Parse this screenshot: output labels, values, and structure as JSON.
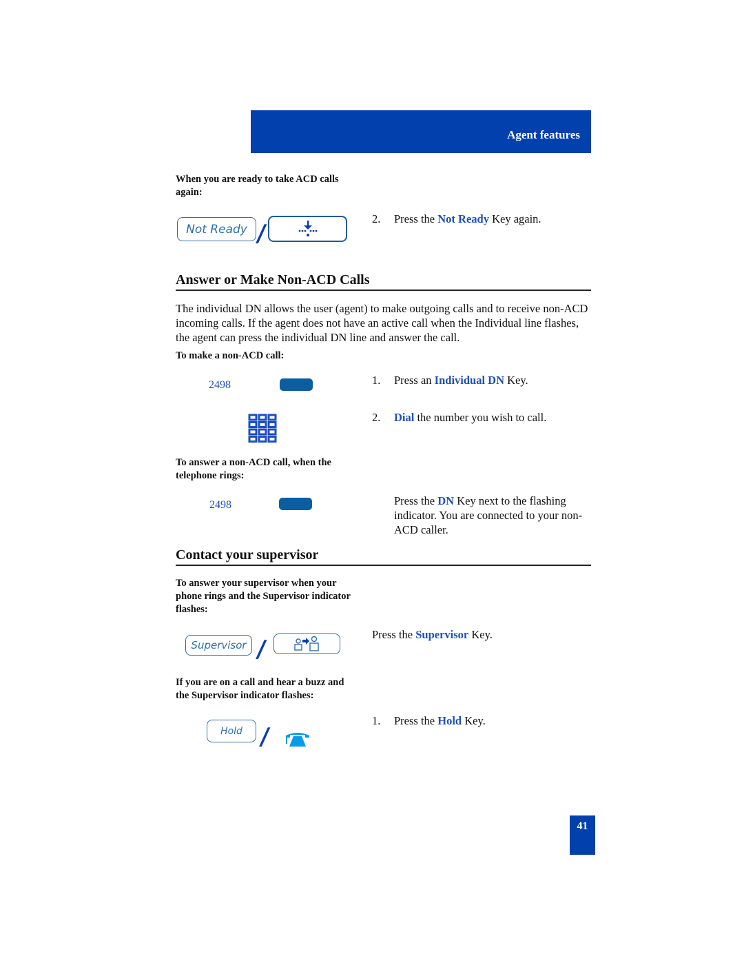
{
  "header": {
    "title": "Agent features",
    "color": "#0140ad"
  },
  "ready_section": {
    "label": "When you are ready to take ACD calls again:",
    "not_ready_key": "Not Ready",
    "step": {
      "number": "2.",
      "pre": "Press the ",
      "highlight": "Not Ready",
      "post": " Key again."
    }
  },
  "non_acd_section": {
    "heading": "Answer or Make Non-ACD Calls",
    "intro": "The individual DN allows the user (agent) to make outgoing calls and to receive non-ACD incoming calls. If the agent does not have an active call when the Individual line flashes, the agent can press the individual DN line and answer the call.",
    "make_call": {
      "label": "To make a non-ACD call:",
      "dn_number": "2498",
      "steps": [
        {
          "number": "1.",
          "pre": "Press an ",
          "highlight": "Individual DN",
          "post": " Key."
        },
        {
          "number": "2.",
          "pre": "",
          "highlight": "Dial",
          "post": " the number you wish to call."
        }
      ]
    },
    "answer_call": {
      "label": "To answer a non-ACD call, when the telephone rings:",
      "dn_number": "2498",
      "step": {
        "pre": "Press the ",
        "highlight": "DN",
        "post": " Key next to the flashing indicator. You are connected to your non-ACD caller."
      }
    }
  },
  "supervisor_section": {
    "heading": "Contact your supervisor",
    "answer": {
      "label": "To answer your supervisor when your phone rings and the Supervisor indicator flashes:",
      "supervisor_key": "Supervisor",
      "step": {
        "pre": "Press the ",
        "highlight": "Supervisor",
        "post": " Key."
      }
    },
    "buzz": {
      "label": "If you are on a call and hear a buzz and the Supervisor indicator flashes:",
      "hold_key": "Hold",
      "step": {
        "number": "1.",
        "pre": "Press the ",
        "highlight": "Hold",
        "post": " Key."
      }
    }
  },
  "slash_separator": "/",
  "page_number": "41"
}
